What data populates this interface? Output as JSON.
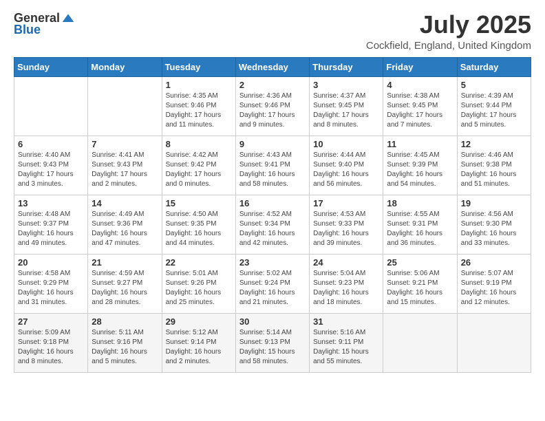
{
  "logo": {
    "general": "General",
    "blue": "Blue"
  },
  "header": {
    "month": "July 2025",
    "location": "Cockfield, England, United Kingdom"
  },
  "weekdays": [
    "Sunday",
    "Monday",
    "Tuesday",
    "Wednesday",
    "Thursday",
    "Friday",
    "Saturday"
  ],
  "weeks": [
    [
      {
        "day": "",
        "info": ""
      },
      {
        "day": "",
        "info": ""
      },
      {
        "day": "1",
        "info": "Sunrise: 4:35 AM\nSunset: 9:46 PM\nDaylight: 17 hours and 11 minutes."
      },
      {
        "day": "2",
        "info": "Sunrise: 4:36 AM\nSunset: 9:46 PM\nDaylight: 17 hours and 9 minutes."
      },
      {
        "day": "3",
        "info": "Sunrise: 4:37 AM\nSunset: 9:45 PM\nDaylight: 17 hours and 8 minutes."
      },
      {
        "day": "4",
        "info": "Sunrise: 4:38 AM\nSunset: 9:45 PM\nDaylight: 17 hours and 7 minutes."
      },
      {
        "day": "5",
        "info": "Sunrise: 4:39 AM\nSunset: 9:44 PM\nDaylight: 17 hours and 5 minutes."
      }
    ],
    [
      {
        "day": "6",
        "info": "Sunrise: 4:40 AM\nSunset: 9:43 PM\nDaylight: 17 hours and 3 minutes."
      },
      {
        "day": "7",
        "info": "Sunrise: 4:41 AM\nSunset: 9:43 PM\nDaylight: 17 hours and 2 minutes."
      },
      {
        "day": "8",
        "info": "Sunrise: 4:42 AM\nSunset: 9:42 PM\nDaylight: 17 hours and 0 minutes."
      },
      {
        "day": "9",
        "info": "Sunrise: 4:43 AM\nSunset: 9:41 PM\nDaylight: 16 hours and 58 minutes."
      },
      {
        "day": "10",
        "info": "Sunrise: 4:44 AM\nSunset: 9:40 PM\nDaylight: 16 hours and 56 minutes."
      },
      {
        "day": "11",
        "info": "Sunrise: 4:45 AM\nSunset: 9:39 PM\nDaylight: 16 hours and 54 minutes."
      },
      {
        "day": "12",
        "info": "Sunrise: 4:46 AM\nSunset: 9:38 PM\nDaylight: 16 hours and 51 minutes."
      }
    ],
    [
      {
        "day": "13",
        "info": "Sunrise: 4:48 AM\nSunset: 9:37 PM\nDaylight: 16 hours and 49 minutes."
      },
      {
        "day": "14",
        "info": "Sunrise: 4:49 AM\nSunset: 9:36 PM\nDaylight: 16 hours and 47 minutes."
      },
      {
        "day": "15",
        "info": "Sunrise: 4:50 AM\nSunset: 9:35 PM\nDaylight: 16 hours and 44 minutes."
      },
      {
        "day": "16",
        "info": "Sunrise: 4:52 AM\nSunset: 9:34 PM\nDaylight: 16 hours and 42 minutes."
      },
      {
        "day": "17",
        "info": "Sunrise: 4:53 AM\nSunset: 9:33 PM\nDaylight: 16 hours and 39 minutes."
      },
      {
        "day": "18",
        "info": "Sunrise: 4:55 AM\nSunset: 9:31 PM\nDaylight: 16 hours and 36 minutes."
      },
      {
        "day": "19",
        "info": "Sunrise: 4:56 AM\nSunset: 9:30 PM\nDaylight: 16 hours and 33 minutes."
      }
    ],
    [
      {
        "day": "20",
        "info": "Sunrise: 4:58 AM\nSunset: 9:29 PM\nDaylight: 16 hours and 31 minutes."
      },
      {
        "day": "21",
        "info": "Sunrise: 4:59 AM\nSunset: 9:27 PM\nDaylight: 16 hours and 28 minutes."
      },
      {
        "day": "22",
        "info": "Sunrise: 5:01 AM\nSunset: 9:26 PM\nDaylight: 16 hours and 25 minutes."
      },
      {
        "day": "23",
        "info": "Sunrise: 5:02 AM\nSunset: 9:24 PM\nDaylight: 16 hours and 21 minutes."
      },
      {
        "day": "24",
        "info": "Sunrise: 5:04 AM\nSunset: 9:23 PM\nDaylight: 16 hours and 18 minutes."
      },
      {
        "day": "25",
        "info": "Sunrise: 5:06 AM\nSunset: 9:21 PM\nDaylight: 16 hours and 15 minutes."
      },
      {
        "day": "26",
        "info": "Sunrise: 5:07 AM\nSunset: 9:19 PM\nDaylight: 16 hours and 12 minutes."
      }
    ],
    [
      {
        "day": "27",
        "info": "Sunrise: 5:09 AM\nSunset: 9:18 PM\nDaylight: 16 hours and 8 minutes."
      },
      {
        "day": "28",
        "info": "Sunrise: 5:11 AM\nSunset: 9:16 PM\nDaylight: 16 hours and 5 minutes."
      },
      {
        "day": "29",
        "info": "Sunrise: 5:12 AM\nSunset: 9:14 PM\nDaylight: 16 hours and 2 minutes."
      },
      {
        "day": "30",
        "info": "Sunrise: 5:14 AM\nSunset: 9:13 PM\nDaylight: 15 hours and 58 minutes."
      },
      {
        "day": "31",
        "info": "Sunrise: 5:16 AM\nSunset: 9:11 PM\nDaylight: 15 hours and 55 minutes."
      },
      {
        "day": "",
        "info": ""
      },
      {
        "day": "",
        "info": ""
      }
    ]
  ]
}
